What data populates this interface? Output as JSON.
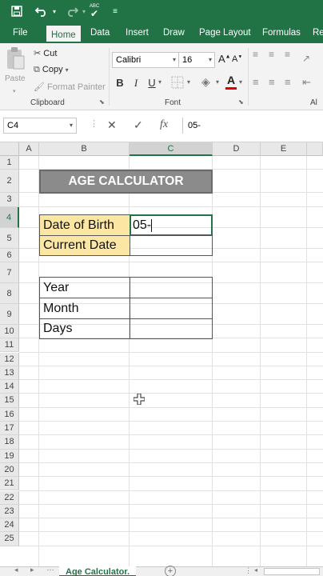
{
  "qat": {
    "save_icon": "save-icon",
    "undo_icon": "undo-icon",
    "redo_icon": "redo-icon",
    "spelling_icon": "spelling-check-icon",
    "custom_icon": "customize-icon"
  },
  "tabs": [
    {
      "label": "File"
    },
    {
      "label": "Home"
    },
    {
      "label": "Data"
    },
    {
      "label": "Insert"
    },
    {
      "label": "Draw"
    },
    {
      "label": "Page Layout"
    },
    {
      "label": "Formulas"
    },
    {
      "label": "Re"
    }
  ],
  "ribbon": {
    "clipboard": {
      "paste": "Paste",
      "cut": "Cut",
      "copy": "Copy",
      "format_painter": "Format Painter",
      "label": "Clipboard"
    },
    "font": {
      "family": "Calibri",
      "size": "16",
      "bold": "B",
      "italic": "I",
      "underline": "U",
      "label": "Font",
      "font_color": "#e00000"
    },
    "alignment": {
      "label": "Al"
    }
  },
  "formula_bar": {
    "name_box": "C4",
    "cancel": "✕",
    "enter": "✓",
    "fx": "fx",
    "value": "05-"
  },
  "grid": {
    "columns": [
      "A",
      "B",
      "C",
      "D",
      "E"
    ],
    "selected_column": "C",
    "rows": [
      "1",
      "2",
      "3",
      "4",
      "5",
      "6",
      "7",
      "8",
      "9",
      "10",
      "11",
      "12",
      "13",
      "14",
      "15",
      "16",
      "17",
      "18",
      "19",
      "20",
      "21",
      "22",
      "23",
      "24",
      "25"
    ],
    "selected_row": "4",
    "title": "AGE CALCULATOR",
    "date_of_birth_label": "Date of Birth",
    "date_of_birth_value": "05-",
    "current_date_label": "Current Date",
    "year_label": "Year",
    "month_label": "Month",
    "days_label": "Days",
    "accent": "#217346",
    "label_fill": "#fce6a4"
  },
  "sheets": {
    "active": "Age Calculator."
  }
}
